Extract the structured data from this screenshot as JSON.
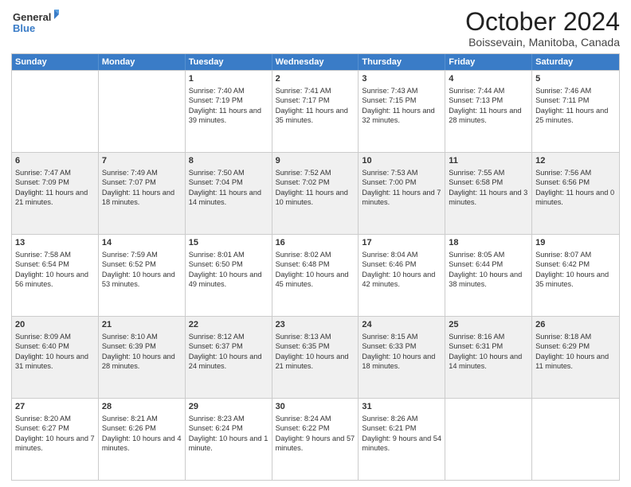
{
  "logo": {
    "general": "General",
    "blue": "Blue"
  },
  "title": "October 2024",
  "location": "Boissevain, Manitoba, Canada",
  "days_of_week": [
    "Sunday",
    "Monday",
    "Tuesday",
    "Wednesday",
    "Thursday",
    "Friday",
    "Saturday"
  ],
  "rows": [
    {
      "alt": false,
      "cells": [
        {
          "day": "",
          "content": ""
        },
        {
          "day": "",
          "content": ""
        },
        {
          "day": "1",
          "content": "Sunrise: 7:40 AM\nSunset: 7:19 PM\nDaylight: 11 hours and 39 minutes."
        },
        {
          "day": "2",
          "content": "Sunrise: 7:41 AM\nSunset: 7:17 PM\nDaylight: 11 hours and 35 minutes."
        },
        {
          "day": "3",
          "content": "Sunrise: 7:43 AM\nSunset: 7:15 PM\nDaylight: 11 hours and 32 minutes."
        },
        {
          "day": "4",
          "content": "Sunrise: 7:44 AM\nSunset: 7:13 PM\nDaylight: 11 hours and 28 minutes."
        },
        {
          "day": "5",
          "content": "Sunrise: 7:46 AM\nSunset: 7:11 PM\nDaylight: 11 hours and 25 minutes."
        }
      ]
    },
    {
      "alt": true,
      "cells": [
        {
          "day": "6",
          "content": "Sunrise: 7:47 AM\nSunset: 7:09 PM\nDaylight: 11 hours and 21 minutes."
        },
        {
          "day": "7",
          "content": "Sunrise: 7:49 AM\nSunset: 7:07 PM\nDaylight: 11 hours and 18 minutes."
        },
        {
          "day": "8",
          "content": "Sunrise: 7:50 AM\nSunset: 7:04 PM\nDaylight: 11 hours and 14 minutes."
        },
        {
          "day": "9",
          "content": "Sunrise: 7:52 AM\nSunset: 7:02 PM\nDaylight: 11 hours and 10 minutes."
        },
        {
          "day": "10",
          "content": "Sunrise: 7:53 AM\nSunset: 7:00 PM\nDaylight: 11 hours and 7 minutes."
        },
        {
          "day": "11",
          "content": "Sunrise: 7:55 AM\nSunset: 6:58 PM\nDaylight: 11 hours and 3 minutes."
        },
        {
          "day": "12",
          "content": "Sunrise: 7:56 AM\nSunset: 6:56 PM\nDaylight: 11 hours and 0 minutes."
        }
      ]
    },
    {
      "alt": false,
      "cells": [
        {
          "day": "13",
          "content": "Sunrise: 7:58 AM\nSunset: 6:54 PM\nDaylight: 10 hours and 56 minutes."
        },
        {
          "day": "14",
          "content": "Sunrise: 7:59 AM\nSunset: 6:52 PM\nDaylight: 10 hours and 53 minutes."
        },
        {
          "day": "15",
          "content": "Sunrise: 8:01 AM\nSunset: 6:50 PM\nDaylight: 10 hours and 49 minutes."
        },
        {
          "day": "16",
          "content": "Sunrise: 8:02 AM\nSunset: 6:48 PM\nDaylight: 10 hours and 45 minutes."
        },
        {
          "day": "17",
          "content": "Sunrise: 8:04 AM\nSunset: 6:46 PM\nDaylight: 10 hours and 42 minutes."
        },
        {
          "day": "18",
          "content": "Sunrise: 8:05 AM\nSunset: 6:44 PM\nDaylight: 10 hours and 38 minutes."
        },
        {
          "day": "19",
          "content": "Sunrise: 8:07 AM\nSunset: 6:42 PM\nDaylight: 10 hours and 35 minutes."
        }
      ]
    },
    {
      "alt": true,
      "cells": [
        {
          "day": "20",
          "content": "Sunrise: 8:09 AM\nSunset: 6:40 PM\nDaylight: 10 hours and 31 minutes."
        },
        {
          "day": "21",
          "content": "Sunrise: 8:10 AM\nSunset: 6:39 PM\nDaylight: 10 hours and 28 minutes."
        },
        {
          "day": "22",
          "content": "Sunrise: 8:12 AM\nSunset: 6:37 PM\nDaylight: 10 hours and 24 minutes."
        },
        {
          "day": "23",
          "content": "Sunrise: 8:13 AM\nSunset: 6:35 PM\nDaylight: 10 hours and 21 minutes."
        },
        {
          "day": "24",
          "content": "Sunrise: 8:15 AM\nSunset: 6:33 PM\nDaylight: 10 hours and 18 minutes."
        },
        {
          "day": "25",
          "content": "Sunrise: 8:16 AM\nSunset: 6:31 PM\nDaylight: 10 hours and 14 minutes."
        },
        {
          "day": "26",
          "content": "Sunrise: 8:18 AM\nSunset: 6:29 PM\nDaylight: 10 hours and 11 minutes."
        }
      ]
    },
    {
      "alt": false,
      "cells": [
        {
          "day": "27",
          "content": "Sunrise: 8:20 AM\nSunset: 6:27 PM\nDaylight: 10 hours and 7 minutes."
        },
        {
          "day": "28",
          "content": "Sunrise: 8:21 AM\nSunset: 6:26 PM\nDaylight: 10 hours and 4 minutes."
        },
        {
          "day": "29",
          "content": "Sunrise: 8:23 AM\nSunset: 6:24 PM\nDaylight: 10 hours and 1 minute."
        },
        {
          "day": "30",
          "content": "Sunrise: 8:24 AM\nSunset: 6:22 PM\nDaylight: 9 hours and 57 minutes."
        },
        {
          "day": "31",
          "content": "Sunrise: 8:26 AM\nSunset: 6:21 PM\nDaylight: 9 hours and 54 minutes."
        },
        {
          "day": "",
          "content": ""
        },
        {
          "day": "",
          "content": ""
        }
      ]
    }
  ]
}
